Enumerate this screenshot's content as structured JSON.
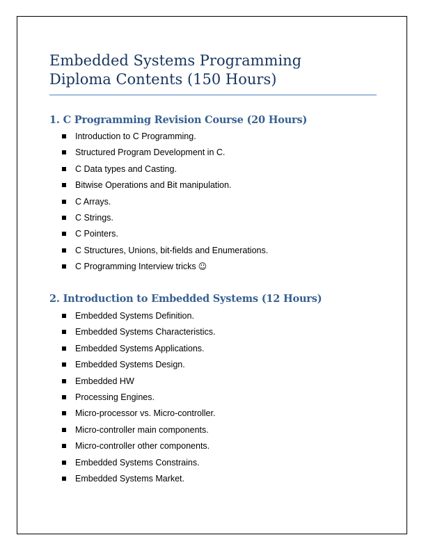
{
  "document": {
    "title_line_1": "Embedded Systems Programming",
    "title_line_2": "Diploma Contents (150 Hours)"
  },
  "sections": [
    {
      "heading": "1. C Programming Revision Course (20 Hours)",
      "items": [
        "Introduction to C Programming.",
        "Structured Program Development in C.",
        "C Data types and Casting.",
        "Bitwise Operations and Bit manipulation.",
        "C Arrays.",
        "C Strings.",
        "C Pointers.",
        "C Structures, Unions, bit-fields and Enumerations.",
        "C Programming Interview tricks"
      ],
      "last_item_icon": "smiley-face-icon",
      "last_item_glyph": "☺"
    },
    {
      "heading": "2.  Introduction to Embedded Systems (12 Hours)",
      "items": [
        "Embedded Systems Definition.",
        "Embedded Systems Characteristics.",
        "Embedded Systems Applications.",
        "Embedded Systems Design.",
        "Embedded HW",
        "Processing Engines.",
        "Micro-processor vs. Micro-controller.",
        "Micro-controller main components.",
        "Micro-controller other components.",
        "Embedded Systems Constrains.",
        "Embedded Systems Market."
      ]
    }
  ],
  "colors": {
    "title": "#17365d",
    "heading": "#365f91",
    "rule": "#4f81bd",
    "text": "#000000"
  }
}
